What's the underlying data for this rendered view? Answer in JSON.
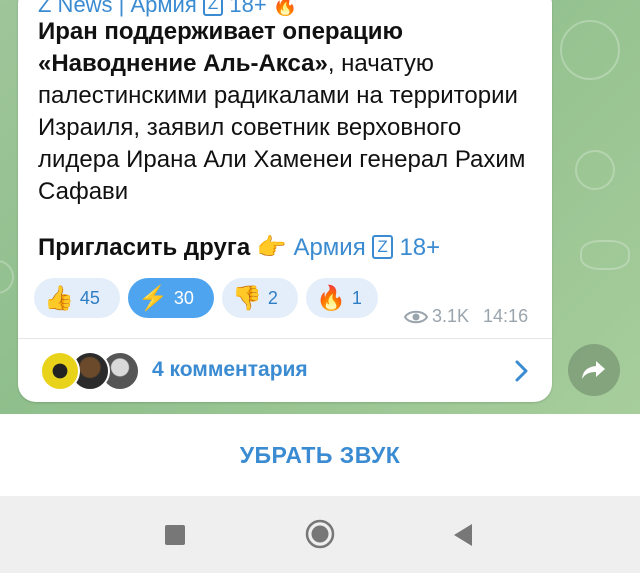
{
  "post": {
    "header_partial": "Z News | Армия",
    "header_z": "Z",
    "header_age": "18+",
    "text_bold": "Иран поддерживает операцию «Наводнение Аль-Акса»",
    "text_rest": ", начатую палестинскими радикалами на территории Израиля, заявил советник верховного лидера Ирана Али Хаменеи генерал Рахим Сафави",
    "invite_bold": "Пригласить друга",
    "invite_emoji": "👉",
    "invite_link": "Армия",
    "invite_z": "Z",
    "invite_age": "18+"
  },
  "reactions": [
    {
      "emoji": "👍",
      "count": "45",
      "active": false
    },
    {
      "emoji": "⚡",
      "count": "30",
      "active": true
    },
    {
      "emoji": "👎",
      "count": "2",
      "active": false
    },
    {
      "emoji": "🔥",
      "count": "1",
      "active": false
    }
  ],
  "meta": {
    "views": "3.1K",
    "time": "14:16"
  },
  "comments": {
    "label": "4 комментария"
  },
  "mute_bar": {
    "label": "УБРАТЬ ЗВУК"
  },
  "colors": {
    "accent": "#3a8bd1",
    "chat_bg": "#9fc59a",
    "active_reaction": "#4ea4ee"
  }
}
